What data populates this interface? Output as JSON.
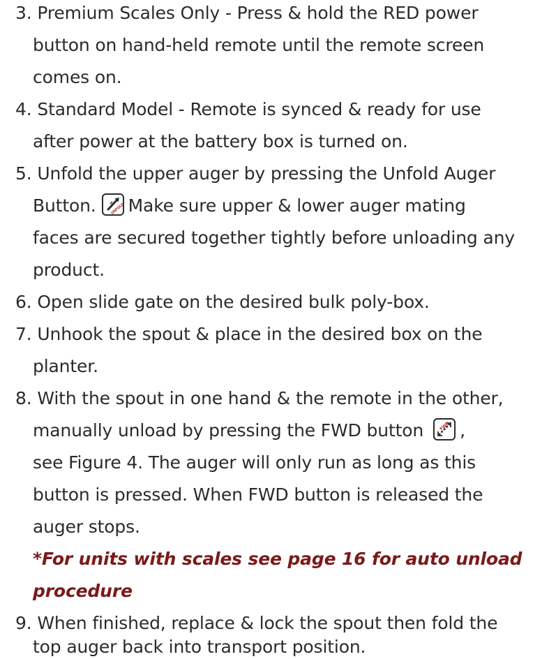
{
  "step3": {
    "line1": "3. Premium Scales Only - Press & hold the RED power",
    "line2": "button on hand-held remote until the remote screen",
    "line3": "comes on."
  },
  "step4": {
    "line1": "4. Standard Model - Remote is synced & ready for use",
    "line2": "after power at the battery box is turned on."
  },
  "step5": {
    "line1": "5. Unfold the upper auger by pressing the Unfold Auger",
    "line2a": "Button.",
    "line2b": "Make sure upper & lower auger mating",
    "line3": "faces are secured together tightly before unloading any",
    "line4": "product.",
    "icon": "unfold-auger-icon",
    "icon_text": "UNFOLD"
  },
  "step6": {
    "line1": "6. Open slide gate on the desired bulk poly-box."
  },
  "step7": {
    "line1": "7. Unhook the spout & place in the desired box on the",
    "line2": "planter."
  },
  "step8": {
    "line1": "8. With the spout in one hand & the remote in the other,",
    "line2a": "manually unload by pressing the FWD button",
    "line2b": ",",
    "line3": "see Figure 4. The auger will only run as long as this",
    "line4": "button is pressed. When FWD button is released the",
    "line5": "auger stops.",
    "icon": "fwd-button-icon",
    "icon_text": "FWD"
  },
  "note": {
    "line1": "*For units with scales see page 16 for auto unload",
    "line2": "procedure",
    "color": "#7a1a1a"
  },
  "step9": {
    "line1": "9. When finished, replace & lock the spout then fold the",
    "line2": "top auger back into transport position."
  }
}
